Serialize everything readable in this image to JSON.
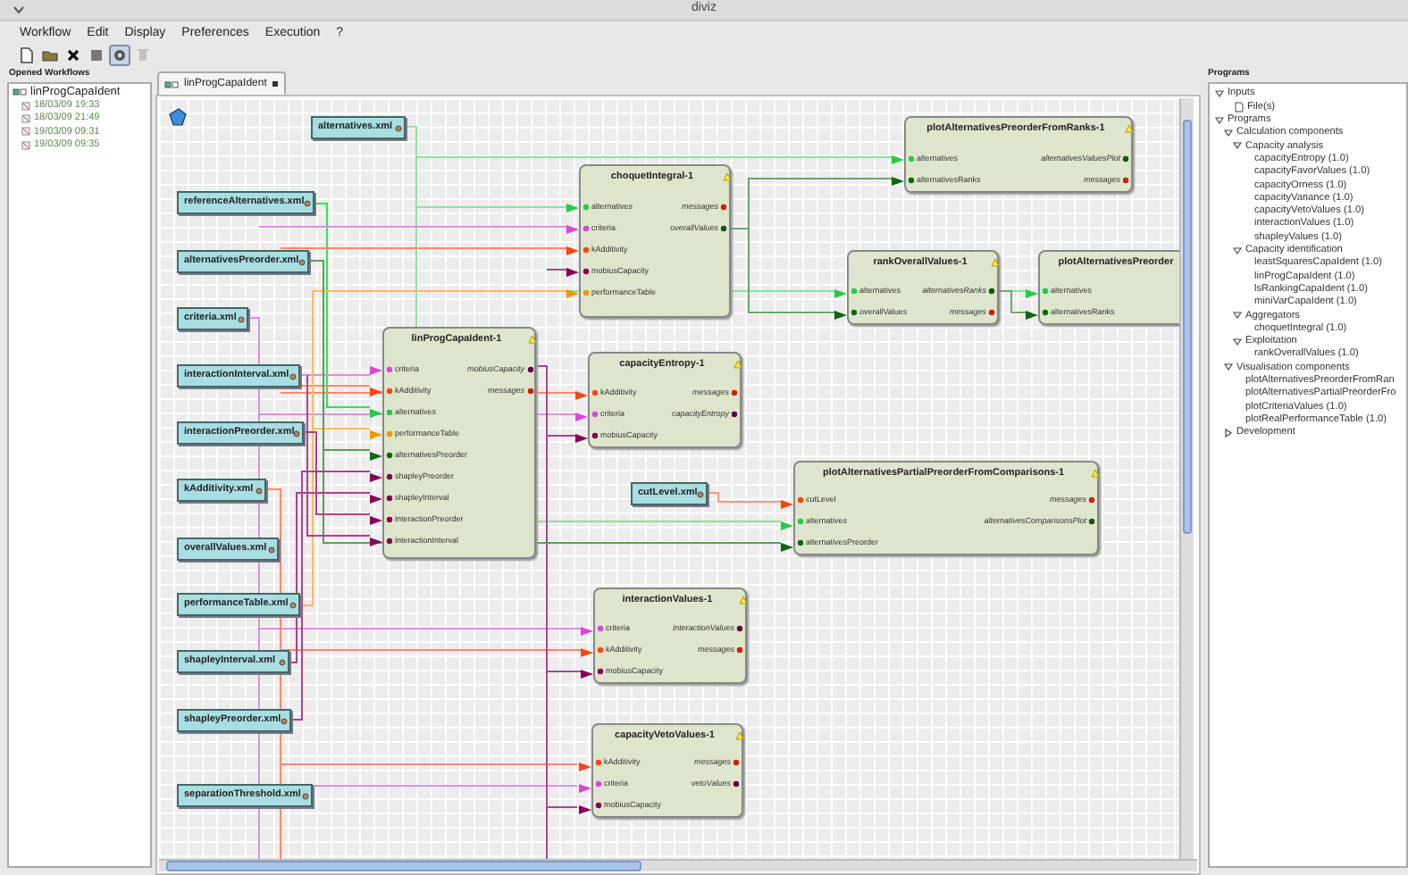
{
  "window": {
    "title": "diviz"
  },
  "menu": [
    "Workflow",
    "Edit",
    "Display",
    "Preferences",
    "Execution",
    "?"
  ],
  "toolbar": [
    {
      "kind": "new",
      "selected": false,
      "disabled": false
    },
    {
      "kind": "open",
      "selected": false,
      "disabled": false
    },
    {
      "kind": "close",
      "selected": false,
      "disabled": false
    },
    {
      "kind": "stop",
      "selected": false,
      "disabled": false
    },
    {
      "kind": "run",
      "selected": true,
      "disabled": false
    },
    {
      "kind": "delete",
      "selected": false,
      "disabled": true
    }
  ],
  "opened_workflows": {
    "title": "Opened Workflows",
    "items": [
      {
        "label": "linProgCapaIdent",
        "children": [
          {
            "label": "18/03/09 19:33"
          },
          {
            "label": "18/03/09 21:49"
          },
          {
            "label": "19/03/09 09:31"
          },
          {
            "label": "19/03/09 09:35"
          }
        ]
      }
    ]
  },
  "editor_tab": {
    "label": "linProgCapaIdent",
    "selected": true
  },
  "canvas": {
    "files": [
      {
        "label": "alternatives.xml"
      },
      {
        "label": "referenceAlternatives.xml"
      },
      {
        "label": "alternativesPreorder.xml"
      },
      {
        "label": "criteria.xml"
      },
      {
        "label": "interactionInterval.xml"
      },
      {
        "label": "interactionPreorder.xml"
      },
      {
        "label": "kAdditivity.xml"
      },
      {
        "label": "overallValues.xml"
      },
      {
        "label": "performanceTable.xml"
      },
      {
        "label": "shapleyInterval.xml"
      },
      {
        "label": "shapleyPreorder.xml"
      },
      {
        "label": "separationThreshold.xml"
      },
      {
        "label": "cutLevel.xml"
      }
    ],
    "modules": [
      {
        "title": "choquetIntegral-1",
        "inputs": [
          {
            "label": "alternatives",
            "color": "#22cc44"
          },
          {
            "label": "criteria",
            "color": "#dd44dd"
          },
          {
            "label": "kAdditivity",
            "color": "#ff4411"
          },
          {
            "label": "mobiusCapacity",
            "color": "#880055"
          },
          {
            "label": "performanceTable",
            "color": "#ee9900"
          }
        ],
        "outputs": [
          {
            "label": "messages",
            "color": "#cc2200"
          },
          {
            "label": "overallValues",
            "color": "#115511"
          }
        ]
      },
      {
        "title": "linProgCapaIdent-1",
        "inputs": [
          {
            "label": "criteria",
            "color": "#dd44dd"
          },
          {
            "label": "kAdditivity",
            "color": "#ff4411"
          },
          {
            "label": "alternatives",
            "color": "#22cc44"
          },
          {
            "label": "performanceTable",
            "color": "#ee9900"
          },
          {
            "label": "alternativesPreorder",
            "color": "#116611"
          },
          {
            "label": "shapleyPreorder",
            "color": "#880055"
          },
          {
            "label": "shapleyInterval",
            "color": "#880055"
          },
          {
            "label": "interactionPreorder",
            "color": "#880055"
          },
          {
            "label": "interactionInterval",
            "color": "#880055"
          }
        ],
        "outputs": [
          {
            "label": "mobiusCapacity",
            "color": "#660044"
          },
          {
            "label": "messages",
            "color": "#cc2200"
          }
        ]
      },
      {
        "title": "capacityEntropy-1",
        "inputs": [
          {
            "label": "kAdditivity",
            "color": "#ff4411"
          },
          {
            "label": "criteria",
            "color": "#dd44dd"
          },
          {
            "label": "mobiusCapacity",
            "color": "#880055"
          }
        ],
        "outputs": [
          {
            "label": "messages",
            "color": "#cc2200"
          },
          {
            "label": "capacityEntropy",
            "color": "#660044"
          }
        ]
      },
      {
        "title": "plotAlternativesPreorderFromRanks-1",
        "inputs": [
          {
            "label": "alternatives",
            "color": "#22cc44"
          },
          {
            "label": "alternativesRanks",
            "color": "#116611"
          }
        ],
        "outputs": [
          {
            "label": "alternativesValuesPlot",
            "color": "#115511"
          },
          {
            "label": "messages",
            "color": "#cc2200"
          }
        ]
      },
      {
        "title": "rankOverallValues-1",
        "inputs": [
          {
            "label": "alternatives",
            "color": "#22cc44"
          },
          {
            "label": "overallValues",
            "color": "#116611"
          }
        ],
        "outputs": [
          {
            "label": "alternativesRanks",
            "color": "#115511"
          },
          {
            "label": "messages",
            "color": "#cc2200"
          }
        ]
      },
      {
        "title": "plotAlternativesPreorder",
        "inputs": [
          {
            "label": "alternatives",
            "color": "#22cc44"
          },
          {
            "label": "alternativesRanks",
            "color": "#116611"
          }
        ]
      },
      {
        "title": "plotAlternativesPartialPreorderFromComparisons-1",
        "inputs": [
          {
            "label": "cutLevel",
            "color": "#ff4411"
          },
          {
            "label": "alternatives",
            "color": "#22cc44"
          },
          {
            "label": "alternativesPreorder",
            "color": "#116611"
          }
        ],
        "outputs": [
          {
            "label": "messages",
            "color": "#cc2200"
          },
          {
            "label": "alternativesComparisonsPlot",
            "color": "#115511"
          }
        ]
      },
      {
        "title": "interactionValues-1",
        "inputs": [
          {
            "label": "criteria",
            "color": "#dd44dd"
          },
          {
            "label": "kAdditivity",
            "color": "#ff4411"
          },
          {
            "label": "mobiusCapacity",
            "color": "#880055"
          }
        ],
        "outputs": [
          {
            "label": "interactionValues",
            "color": "#660044"
          },
          {
            "label": "messages",
            "color": "#cc2200"
          }
        ]
      },
      {
        "title": "capacityVetoValues-1",
        "inputs": [
          {
            "label": "kAdditivity",
            "color": "#ff4411"
          },
          {
            "label": "criteria",
            "color": "#dd44dd"
          },
          {
            "label": "mobiusCapacity",
            "color": "#880055"
          }
        ],
        "outputs": [
          {
            "label": "messages",
            "color": "#cc2200"
          },
          {
            "label": "vetoValues",
            "color": "#660044"
          }
        ]
      }
    ]
  },
  "programs": {
    "title": "Programs",
    "tree": [
      {
        "label": "Inputs",
        "expanded": true,
        "children": [
          {
            "label": "File(s)",
            "kind": "file"
          }
        ]
      },
      {
        "label": "Programs",
        "expanded": true,
        "children": [
          {
            "label": "Calculation components",
            "expanded": true,
            "children": [
              {
                "label": "Capacity  analysis",
                "expanded": true,
                "children": [
                  {
                    "label": "capacityEntropy (1.0)"
                  },
                  {
                    "label": "capacityFavorValues (1.0)"
                  },
                  {
                    "label": "capacityOrness (1.0)"
                  },
                  {
                    "label": "capacityVariance (1.0)"
                  },
                  {
                    "label": "capacityVetoValues (1.0)"
                  },
                  {
                    "label": "interactionValues (1.0)"
                  },
                  {
                    "label": "shapleyValues (1.0)"
                  }
                ]
              },
              {
                "label": "Capacity  identification",
                "expanded": true,
                "children": [
                  {
                    "label": "leastSquaresCapaIdent (1.0)"
                  },
                  {
                    "label": "linProgCapaIdent (1.0)"
                  },
                  {
                    "label": "lsRankingCapaIdent (1.0)"
                  },
                  {
                    "label": "miniVarCapaIdent (1.0)"
                  }
                ]
              },
              {
                "label": "Aggregators",
                "expanded": true,
                "children": [
                  {
                    "label": "choquetIntegral (1.0)"
                  }
                ]
              },
              {
                "label": "Exploitation",
                "expanded": true,
                "children": [
                  {
                    "label": "rankOverallValues (1.0)"
                  }
                ]
              }
            ]
          },
          {
            "label": "Visualisation components",
            "expanded": true,
            "children": [
              {
                "label": "plotAlternativesPreorderFromRan"
              },
              {
                "label": "plotAlternativesPartialPreorderFro"
              },
              {
                "label": "plotCriteriaValues (1.0)"
              },
              {
                "label": "plotRealPerformanceTable (1.0)"
              }
            ]
          },
          {
            "label": "Development",
            "expanded": false
          }
        ]
      }
    ]
  }
}
